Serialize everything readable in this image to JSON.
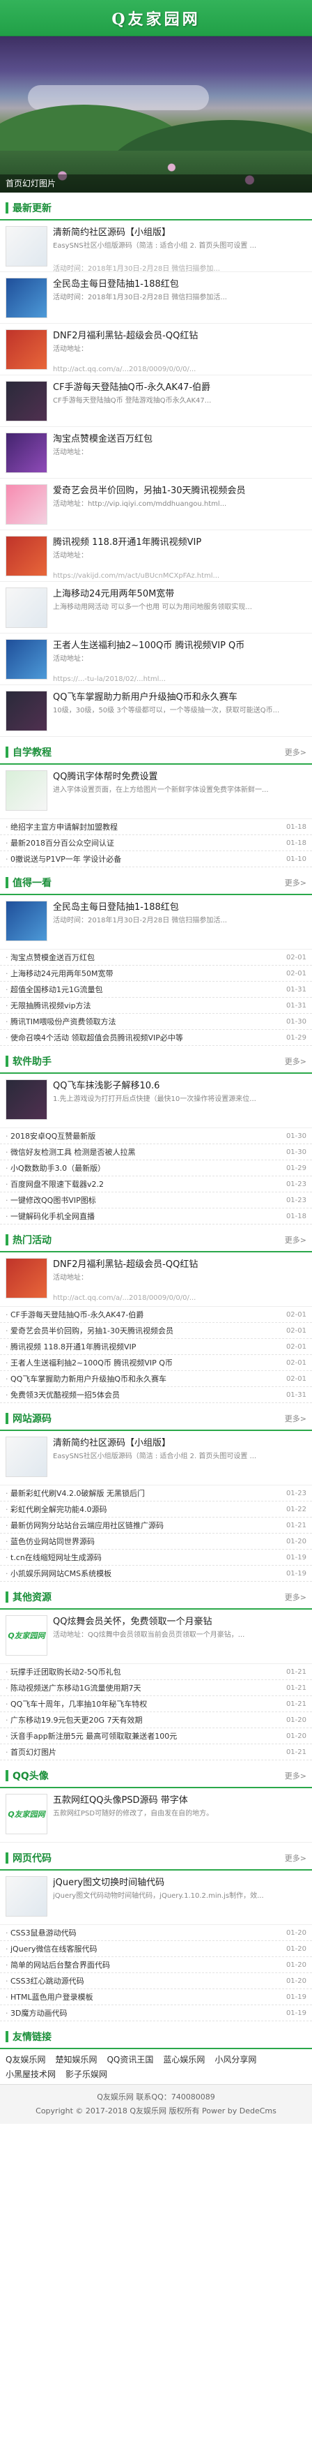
{
  "site": {
    "name": "Q友家园网"
  },
  "banner": {
    "caption": "首页幻灯图片"
  },
  "more_label": "更多>",
  "latest": {
    "title": "最新更新",
    "items": [
      {
        "title": "清新简约社区源码【小组版】",
        "desc": "EasySNS社区小组版源码（简洁 : 适合小组 2. 首页头图可设置 ...",
        "meta": "活动时间：2018年1月30日-2月28日 微信扫描参加...",
        "thumb": "t-white"
      },
      {
        "title": "全民岛主每日登陆抽1-188红包",
        "desc": "活动时间：2018年1月30日-2月28日 微信扫描参加活...",
        "meta": "",
        "thumb": "t-blue"
      },
      {
        "title": "DNF2月福利黑钻-超级会员-QQ红钻",
        "desc": "活动地址：",
        "meta": "http://act.qq.com/a/...2018/0009/0/0/0/...",
        "thumb": "t-red"
      },
      {
        "title": "CF手游每天登陆抽Q币-永久AK47-伯爵",
        "desc": "CF手游每天登陆抽Q币 登陆游戏抽Q币永久AK47...",
        "meta": "",
        "thumb": "t-dark"
      },
      {
        "title": "淘宝点赞模金送百万红包",
        "desc": "活动地址：",
        "meta": "",
        "thumb": "t-purple"
      },
      {
        "title": "爱奇艺会员半价回购，另抽1-30天腾讯视频会员",
        "desc": "活动地址：http://vip.iqiyi.com/mddhuangou.html...",
        "meta": "",
        "thumb": "t-pink"
      },
      {
        "title": "腾讯视频 118.8开通1年腾讯视频VIP",
        "desc": "活动地址：",
        "meta": "https://vakijd.com/m/act/uBUcnMCXpFAz.html...",
        "thumb": "t-red"
      },
      {
        "title": "上海移动24元用两年50M宽带",
        "desc": "上海移动用网活动 可以多一个也用 可以为用问地服务领取实现...",
        "meta": "",
        "thumb": "t-white"
      },
      {
        "title": "王者人生送福利抽2~100Q币 腾讯视频VIP Q币",
        "desc": "活动地址：",
        "meta": "https://...-tu-la/2018/02/...html...",
        "thumb": "t-blue"
      },
      {
        "title": "QQ飞车掌握助力新用户升级抽Q币和永久赛车",
        "desc": "10级，30级，50级 3个等级都可以，一个等级抽一次，获取可能送Q币...",
        "meta": "",
        "thumb": "t-dark"
      }
    ]
  },
  "sections": [
    {
      "title": "自学教程",
      "lead": {
        "title": "QQ腾讯字体帮时免费设置",
        "desc": "进入字体设置页面，在上方给图片一个新鲜字体设置免费字体新鲜一...",
        "meta": "",
        "thumb": "t-green"
      },
      "items": [
        {
          "text": "绝招字主宣方申请解封加盟教程",
          "date": "01-18"
        },
        {
          "text": "最新2018百分百公众空间认证",
          "date": "01-18"
        },
        {
          "text": "0撤说送与P1VP一年 学设计必备",
          "date": "01-10"
        }
      ]
    },
    {
      "title": "值得一看",
      "lead": {
        "title": "全民岛主每日登陆抽1-188红包",
        "desc": "活动时间：2018年1月30日-2月28日 微信扫描参加活...",
        "meta": "",
        "thumb": "t-blue"
      },
      "items": [
        {
          "text": "淘宝点赞模金送百万红包",
          "date": "02-01"
        },
        {
          "text": "上海移动24元用两年50M宽带",
          "date": "02-01"
        },
        {
          "text": "超值全国移动1元1G流量包",
          "date": "01-31"
        },
        {
          "text": "无限抽腾讯视频vip方法",
          "date": "01-31"
        },
        {
          "text": "腾讯TIM喂吸份产资费领取方法",
          "date": "01-30"
        },
        {
          "text": "使命召唤4个活动 领取超值会员腾讯视频VIP必中等",
          "date": "01-29"
        }
      ]
    },
    {
      "title": "软件助手",
      "lead": {
        "title": "QQ飞车抹浅影子解移10.6",
        "desc": "1.先上游戏设为打打开后点快捷（最快10一次操作将设置源来位...",
        "meta": "",
        "thumb": "t-dark"
      },
      "items": [
        {
          "text": "2018安卓QQ互赞最新版",
          "date": "01-30"
        },
        {
          "text": "微信好友检测工具 检测是否被人拉黑",
          "date": "01-30"
        },
        {
          "text": "小Q数数助手3.0（最新版）",
          "date": "01-29"
        },
        {
          "text": "百度网盘不限速下载器v2.2",
          "date": "01-23"
        },
        {
          "text": "一键修改QQ图书VIP图标",
          "date": "01-23"
        },
        {
          "text": "一键解码化手机全网直播",
          "date": "01-18"
        }
      ]
    },
    {
      "title": "热门活动",
      "lead": {
        "title": "DNF2月福利黑钻-超级会员-QQ红钻",
        "desc": "活动地址：",
        "meta": "http://act.qq.com/a/...2018/0009/0/0/0/...",
        "thumb": "t-red"
      },
      "items": [
        {
          "text": "CF手游每天登陆抽Q币-永久AK47-伯爵",
          "date": "02-01"
        },
        {
          "text": "爱奇艺会员半价回购，另抽1-30天腾讯视频会员",
          "date": "02-01"
        },
        {
          "text": "腾讯视频 118.8开通1年腾讯视频VIP",
          "date": "02-01"
        },
        {
          "text": "王者人生送福利抽2~100Q币 腾讯视频VIP Q币",
          "date": "02-01"
        },
        {
          "text": "QQ飞车掌握助力新用户升级抽Q币和永久赛车",
          "date": "02-01"
        },
        {
          "text": "免费领3天优酷视频一招5体会员",
          "date": "01-31"
        }
      ]
    },
    {
      "title": "网站源码",
      "lead": {
        "title": "清新简约社区源码【小组版】",
        "desc": "EasySNS社区小组版源码（简洁 : 适合小组 2. 首页头图可设置 ...",
        "meta": "",
        "thumb": "t-white"
      },
      "items": [
        {
          "text": "最新彩虹代刷V4.2.0破解版 无黑锁后门",
          "date": "01-23"
        },
        {
          "text": "彩虹代刷全解完功能4.0源码",
          "date": "01-22"
        },
        {
          "text": "最新仿网狗分站站台云端应用社区链推广源码",
          "date": "01-21"
        },
        {
          "text": "蓝色仿业网站同世界源码",
          "date": "01-20"
        },
        {
          "text": "t.cn在线缩短网址生成源码",
          "date": "01-19"
        },
        {
          "text": "小凯娱乐网网站CMS系统模板",
          "date": "01-19"
        }
      ]
    },
    {
      "title": "其他资源",
      "lead": {
        "title": "QQ炫舞会员关怀，免费领取一个月豪钻",
        "desc": "活动地址：QQ炫舞中会员领取当前会员页领取一个月豪钻，...",
        "meta": "",
        "thumb": "logo"
      },
      "items": [
        {
          "text": "玩撑手迁团取购长动2-5Q币礼包",
          "date": "01-21"
        },
        {
          "text": "陈动视频送广东移动1G流量使用期7天",
          "date": "01-21"
        },
        {
          "text": "QQ飞车十周年，几率抽10年秘飞车特权",
          "date": "01-21"
        },
        {
          "text": "广东移动19.9元包天更20G 7天有效期",
          "date": "01-20"
        },
        {
          "text": "沃音手app新注册5元 最高可领取取兼送者100元",
          "date": "01-20"
        },
        {
          "text": "首页幻灯图片",
          "date": "01-21"
        }
      ]
    },
    {
      "title": "QQ头像",
      "lead": {
        "title": "五款网红QQ头像PSD源码 带字体",
        "desc": "五款网红PSD可随好的修改了，自由发在自的地方。",
        "meta": "",
        "thumb": "logo"
      },
      "items": []
    },
    {
      "title": "网页代码",
      "lead": {
        "title": "jQuery图文切换时间轴代码",
        "desc": "jQuery图文代码动物时间轴代码，jQuery.1.10.2.min.js制作，效...",
        "meta": "",
        "thumb": "t-white"
      },
      "items": [
        {
          "text": "CSS3鼠悬游动代码",
          "date": "01-20"
        },
        {
          "text": "jQuery微信在线客服代码",
          "date": "01-20"
        },
        {
          "text": "简单的网站后台整合界面代码",
          "date": "01-20"
        },
        {
          "text": "CSS3红心跳动源代码",
          "date": "01-20"
        },
        {
          "text": "HTML蓝色用户登录模板",
          "date": "01-19"
        },
        {
          "text": "3D魔方动画代码",
          "date": "01-19"
        }
      ]
    }
  ],
  "friend_links": {
    "title": "友情链接",
    "links": [
      "Q友娱乐网",
      "楚知娱乐网",
      "QQ资讯王国",
      "蓝心娱乐网",
      "小风分享网",
      "小黑屋技术网",
      "影子乐娱网"
    ]
  },
  "footer": {
    "line1": "Q友娱乐网 联系QQ：740080089",
    "line2": "Copyright © 2017-2018 Q友娱乐网 版权所有 Power by DedeCms"
  }
}
